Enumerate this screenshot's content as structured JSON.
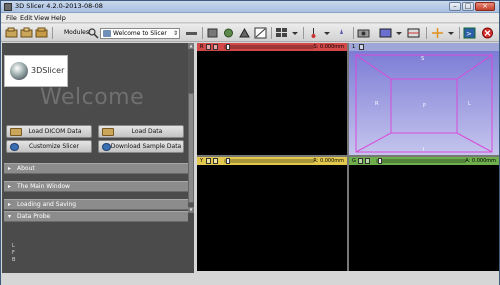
{
  "window": {
    "title": "3D Slicer 4.2.0-2013-08-08"
  },
  "menu": {
    "items": [
      "File",
      "Edit",
      "View",
      "Help"
    ]
  },
  "toolbar": {
    "modules_label": "Modules:",
    "module_selected": "Welcome to Slicer"
  },
  "logo": {
    "text": "3DSlicer"
  },
  "welcome": {
    "heading": "Welcome"
  },
  "actions": {
    "load_dicom": "Load DICOM Data",
    "load_data": "Load Data",
    "customize": "Customize Slicer",
    "download_sample": "Download Sample Data"
  },
  "sections": [
    {
      "label": "About",
      "arrow": "▸"
    },
    {
      "label": "The Main Window",
      "arrow": "▸"
    },
    {
      "label": "Loading and Saving",
      "arrow": "▸"
    },
    {
      "label": "Data Probe",
      "arrow": "▾"
    }
  ],
  "probe": {
    "lines": [
      "L",
      "F",
      "B"
    ]
  },
  "views": {
    "red": {
      "label": "R",
      "offset": "S: 0.000mm",
      "color": "#d34848"
    },
    "yellow": {
      "label": "Y",
      "offset": "R: 0.000mm",
      "color": "#e3c84e"
    },
    "green": {
      "label": "G",
      "offset": "A: 0.000mm",
      "color": "#6fae4d"
    },
    "threed": {
      "label": "1",
      "color": "#9da6d6",
      "orient": {
        "top": "S",
        "left": "R",
        "right": "L",
        "center": "P",
        "bottom": "I"
      },
      "box_color": "#d94ad9"
    }
  }
}
